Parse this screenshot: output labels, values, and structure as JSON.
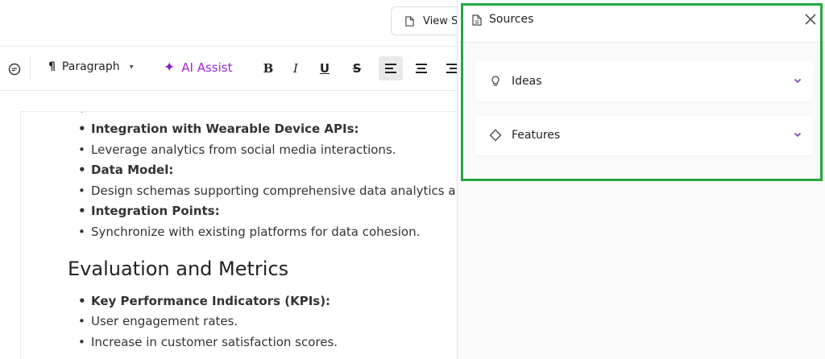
{
  "topbar": {
    "view_label": "View S"
  },
  "toolbar": {
    "paragraph_label": "Paragraph",
    "ai_label": "AI Assist",
    "bold_label": "B",
    "italic_label": "I",
    "underline_label": "U",
    "strike_label": "S"
  },
  "document": {
    "bullets_top": [
      {
        "text": "Integration with Wearable Device APIs:"
      },
      {
        "text": "Leverage analytics from social media interactions."
      },
      {
        "text": "Data Model:"
      },
      {
        "text": "Design schemas supporting comprehensive data analytics and so"
      },
      {
        "text": "Integration Points:"
      },
      {
        "text": "Synchronize with existing platforms for data cohesion."
      }
    ],
    "section_heading": "Evaluation and Metrics",
    "bullets_bottom": [
      {
        "text": "Key Performance Indicators (KPIs):"
      },
      {
        "text": "User engagement rates."
      },
      {
        "text": "Increase in customer satisfaction scores."
      }
    ]
  },
  "panel": {
    "title": "Sources",
    "items": [
      {
        "label": "Ideas",
        "icon": "lightbulb-icon"
      },
      {
        "label": "Features",
        "icon": "diamond-icon"
      }
    ]
  },
  "colors": {
    "ai_accent": "#9b27d4",
    "chevron": "#7a4fa8",
    "highlight": "#22a83f"
  }
}
